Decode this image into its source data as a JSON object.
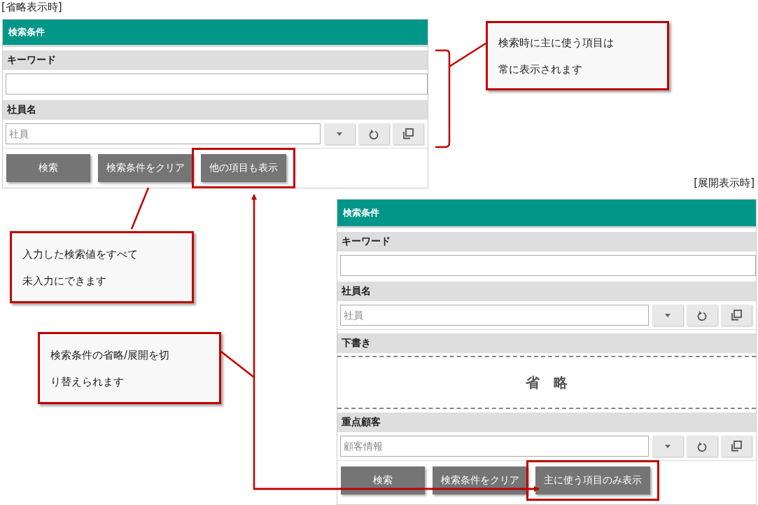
{
  "panels": [
    {
      "caption": "[省略表示時]",
      "title": "検索条件",
      "sections": [
        {
          "kind": "text",
          "label": "キーワード"
        },
        {
          "kind": "lookup",
          "label": "社員名",
          "placeholder": "社員"
        }
      ],
      "buttons": [
        {
          "label": "検索",
          "highlighted": false
        },
        {
          "label": "検索条件をクリア",
          "highlighted": false
        },
        {
          "label": "他の項目も表示",
          "highlighted": true
        }
      ]
    },
    {
      "caption": "[展開表示時]",
      "title": "検索条件",
      "sections": [
        {
          "kind": "text",
          "label": "キーワード"
        },
        {
          "kind": "lookup",
          "label": "社員名",
          "placeholder": "社員"
        },
        {
          "kind": "omitted",
          "label": "下書き",
          "text": "省　略"
        },
        {
          "kind": "lookup",
          "label": "重点顧客",
          "placeholder": "顧客情報"
        }
      ],
      "buttons": [
        {
          "label": "検索",
          "highlighted": false
        },
        {
          "label": "検索条件をクリア",
          "highlighted": false
        },
        {
          "label": "主に使う項目のみ表示",
          "highlighted": true
        }
      ]
    }
  ],
  "callouts": [
    {
      "lines": [
        "検索時に主に使う項目は",
        "常に表示されます"
      ]
    },
    {
      "lines": [
        "入力した検索値をすべて",
        "未入力にできます"
      ]
    },
    {
      "lines": [
        "検索条件の省略/展開を切",
        "り替えられます"
      ]
    }
  ]
}
